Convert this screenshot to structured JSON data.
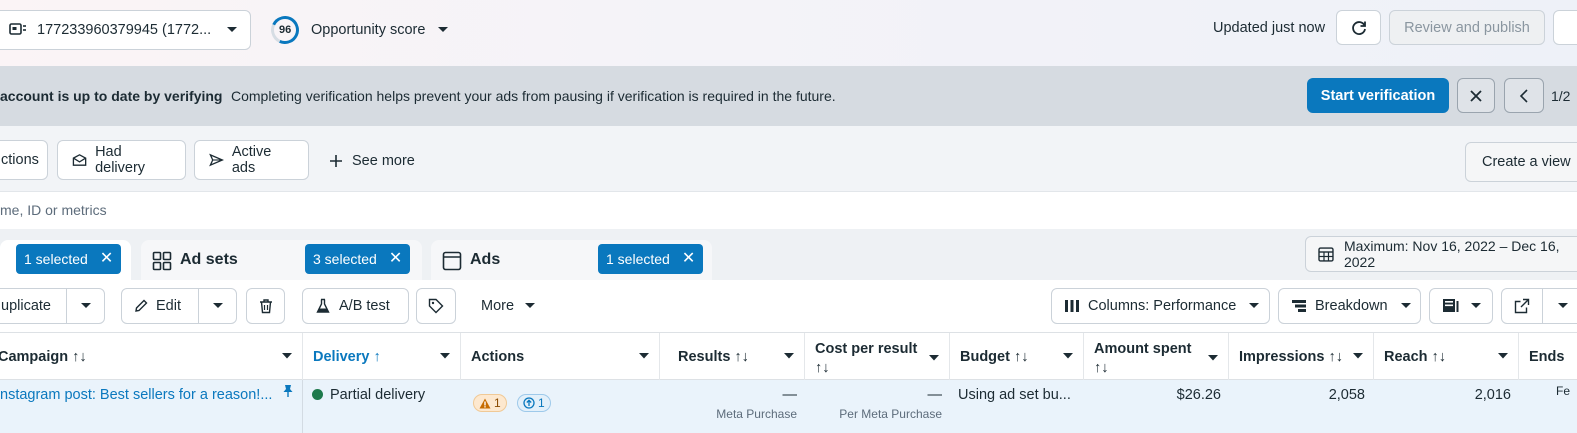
{
  "topbar": {
    "account_id": "177233960379945 (1772...",
    "opportunity_score": "96",
    "opportunity_label": "Opportunity score",
    "updated": "Updated just now",
    "review_publish": "Review and publish"
  },
  "banner": {
    "title": "account is up to date by verifying",
    "message": "Completing verification helps prevent your ads from pausing if verification is required in the future.",
    "start_verification": "Start verification",
    "page_index": "1/2"
  },
  "filters": {
    "chips": [
      "ctions",
      "Had delivery",
      "Active ads"
    ],
    "see_more": "See more",
    "create_view": "Create a view"
  },
  "search": {
    "placeholder": "me, ID or metrics"
  },
  "tabs": {
    "campaigns_selected": "1 selected",
    "adsets_label": "Ad sets",
    "adsets_selected": "3 selected",
    "ads_label": "Ads",
    "ads_selected": "1 selected",
    "date_range": "Maximum: Nov 16, 2022 – Dec 16, 2022"
  },
  "toolbar": {
    "duplicate": "uplicate",
    "edit": "Edit",
    "ab_test": "A/B test",
    "more": "More",
    "columns": "Columns: Performance",
    "breakdown": "Breakdown"
  },
  "table": {
    "headers": {
      "campaign": "Campaign ↑↓",
      "delivery": "Delivery ↑",
      "actions": "Actions",
      "results": "Results ↑↓",
      "cost_per_result_1": "Cost per result",
      "cost_per_result_2": "↑↓",
      "budget": "Budget ↑↓",
      "amount_spent_1": "Amount spent",
      "amount_spent_2": "↑↓",
      "impressions": "Impressions ↑↓",
      "reach": "Reach ↑↓",
      "ends": "Ends"
    },
    "row": {
      "campaign": "nstagram post: Best sellers for a reason!...",
      "delivery": "Partial delivery",
      "warn_count": "1",
      "info_count": "1",
      "results": "—",
      "results_sub": "Meta Purchase",
      "cost_per_result": "—",
      "cost_sub": "Per Meta Purchase",
      "budget": "Using ad set bu...",
      "amount_spent": "$26.26",
      "impressions": "2,058",
      "reach": "2,016",
      "ends": "Fe"
    }
  }
}
